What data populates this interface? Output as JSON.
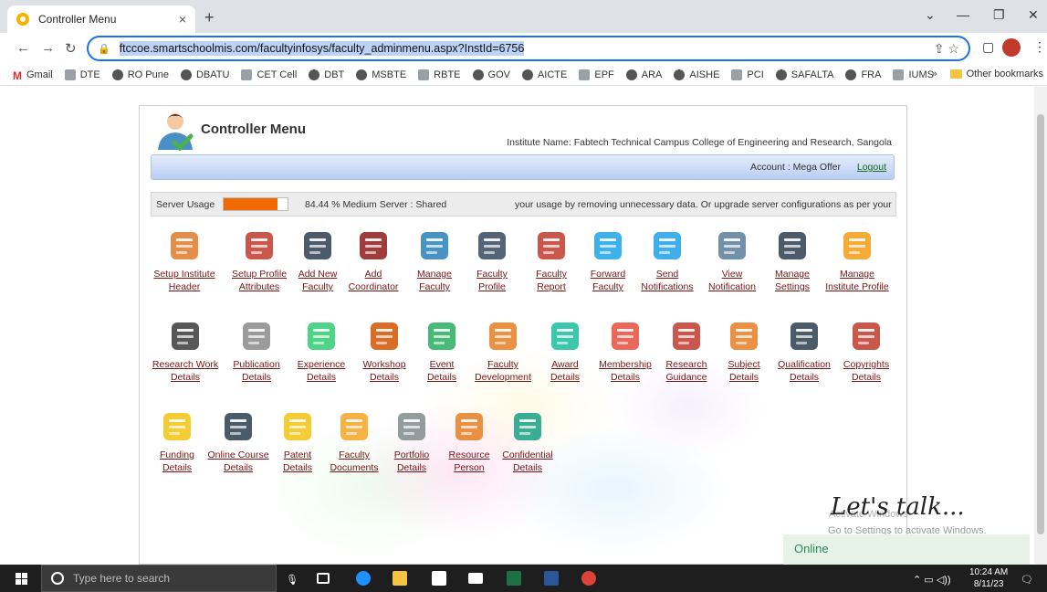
{
  "browser": {
    "tab_title": "Controller Menu",
    "tab_close": "×",
    "new_tab": "+",
    "url": "ftccoe.smartschoolmis.com/facultyinfosys/faculty_adminmenu.aspx?InstId=6756",
    "window_controls": [
      "⌄",
      "—",
      "❐",
      "✕"
    ],
    "bookmarks": [
      "Gmail",
      "DTE",
      "RO Pune",
      "DBATU",
      "CET Cell",
      "DBT",
      "MSBTE",
      "RBTE",
      "GOV",
      "AICTE",
      "EPF",
      "ARA",
      "AISHE",
      "PCI",
      "SAFALTA",
      "FRA",
      "IUMS"
    ],
    "bookmarks_overflow": "»",
    "other_bookmarks": "Other bookmarks"
  },
  "header": {
    "title": "Controller Menu",
    "institute": "Institute Name:  Fabtech Technical Campus College of Engineering and Research, Sangola",
    "account": "Account : Mega Offer",
    "logout": "Logout"
  },
  "usage": {
    "label": "Server Usage",
    "fill_percent": 84.44,
    "text": "84.44 %  Medium  Server : Shared",
    "marquee": "your usage by removing unnecessary data. Or upgrade server configurations as per your"
  },
  "menu": {
    "row1": [
      {
        "l1": "Setup Institute",
        "l2": "Header",
        "icon": "school-building-icon",
        "color": "#e07a2a"
      },
      {
        "l1": "Setup Profile",
        "l2": "Attributes",
        "icon": "colorful-gear-icon",
        "color": "#c0392b"
      },
      {
        "l1": "Add New",
        "l2": "Faculty",
        "icon": "add-user-icon",
        "color": "#2c3e50"
      },
      {
        "l1": "Add",
        "l2": "Coordinator",
        "icon": "coordinator-icon",
        "color": "#8e1b1b"
      },
      {
        "l1": "Manage",
        "l2": "Faculty",
        "icon": "document-edit-icon",
        "color": "#2980b9"
      },
      {
        "l1": "Faculty",
        "l2": "Profile",
        "icon": "id-card-icon",
        "color": "#34495e"
      },
      {
        "l1": "Faculty",
        "l2": "Report",
        "icon": "report-search-icon",
        "color": "#c0392b"
      },
      {
        "l1": "Forward",
        "l2": "Faculty",
        "icon": "forward-icon",
        "color": "#1aa3e8"
      },
      {
        "l1": "Send",
        "l2": "Notifications",
        "icon": "chat-bubble-icon",
        "color": "#1ea0e8"
      },
      {
        "l1": "View",
        "l2": "Notification",
        "icon": "envelope-icon",
        "color": "#5a7d9a"
      },
      {
        "l1": "Manage",
        "l2": "Settings",
        "icon": "tools-icon",
        "color": "#2c3e50"
      },
      {
        "l1": "Manage",
        "l2": "Institute Profile",
        "icon": "tools-badge-icon",
        "color": "#f39c12"
      }
    ],
    "row2": [
      {
        "l1": "Research Work",
        "l2": "Details",
        "icon": "research-gear-icon",
        "color": "#3a3a3a"
      },
      {
        "l1": "Publication",
        "l2": "Details",
        "icon": "publication-icon",
        "color": "#8a8a8a"
      },
      {
        "l1": "Experience",
        "l2": "Details",
        "icon": "gauge-icon",
        "color": "#2ecc71"
      },
      {
        "l1": "Workshop",
        "l2": "Details",
        "icon": "easel-board-icon",
        "color": "#d35400"
      },
      {
        "l1": "Event",
        "l2": "Details",
        "icon": "books-icon",
        "color": "#27ae60"
      },
      {
        "l1": "Faculty",
        "l2": "Development",
        "icon": "chart-magnify-icon",
        "color": "#e67e22"
      },
      {
        "l1": "Award",
        "l2": "Details",
        "icon": "trophy-icon",
        "color": "#1abc9c"
      },
      {
        "l1": "Membership",
        "l2": "Details",
        "icon": "bar-graph-icon",
        "color": "#e74c3c"
      },
      {
        "l1": "Research",
        "l2": "Guidance",
        "icon": "presentation-icon",
        "color": "#c0392b"
      },
      {
        "l1": "Subject",
        "l2": "Details",
        "icon": "document-check-icon",
        "color": "#e67e22"
      },
      {
        "l1": "Qualification",
        "l2": "Details",
        "icon": "graduation-cap-icon",
        "color": "#2c3e50"
      },
      {
        "l1": "Copyrights",
        "l2": "Details",
        "icon": "copyright-icon",
        "color": "#c0392b"
      }
    ],
    "row3": [
      {
        "l1": "Funding",
        "l2": "Details",
        "icon": "money-bag-icon",
        "color": "#f1c40f"
      },
      {
        "l1": "Online Course",
        "l2": "Details",
        "icon": "online-course-icon",
        "color": "#2c3e50"
      },
      {
        "l1": "Patent",
        "l2": "Details",
        "icon": "patent-icon",
        "color": "#f1c40f"
      },
      {
        "l1": "Faculty",
        "l2": "Documents",
        "icon": "folder-icon",
        "color": "#f5a623"
      },
      {
        "l1": "Portfolio",
        "l2": "Details",
        "icon": "portfolio-icon",
        "color": "#7f8c8d"
      },
      {
        "l1": "Resource",
        "l2": "Person",
        "icon": "resource-person-icon",
        "color": "#e67e22"
      },
      {
        "l1": "Confidential",
        "l2": "Details",
        "icon": "confidential-book-icon",
        "color": "#16a085"
      }
    ]
  },
  "chat": {
    "title": "Let's talk...",
    "status": "Online",
    "activate_top": "Activate Windows",
    "activate": "Go to Settings to activate Windows."
  },
  "taskbar": {
    "search_placeholder": "Type here to search",
    "time": "10:24 AM",
    "date": "8/11/23"
  }
}
